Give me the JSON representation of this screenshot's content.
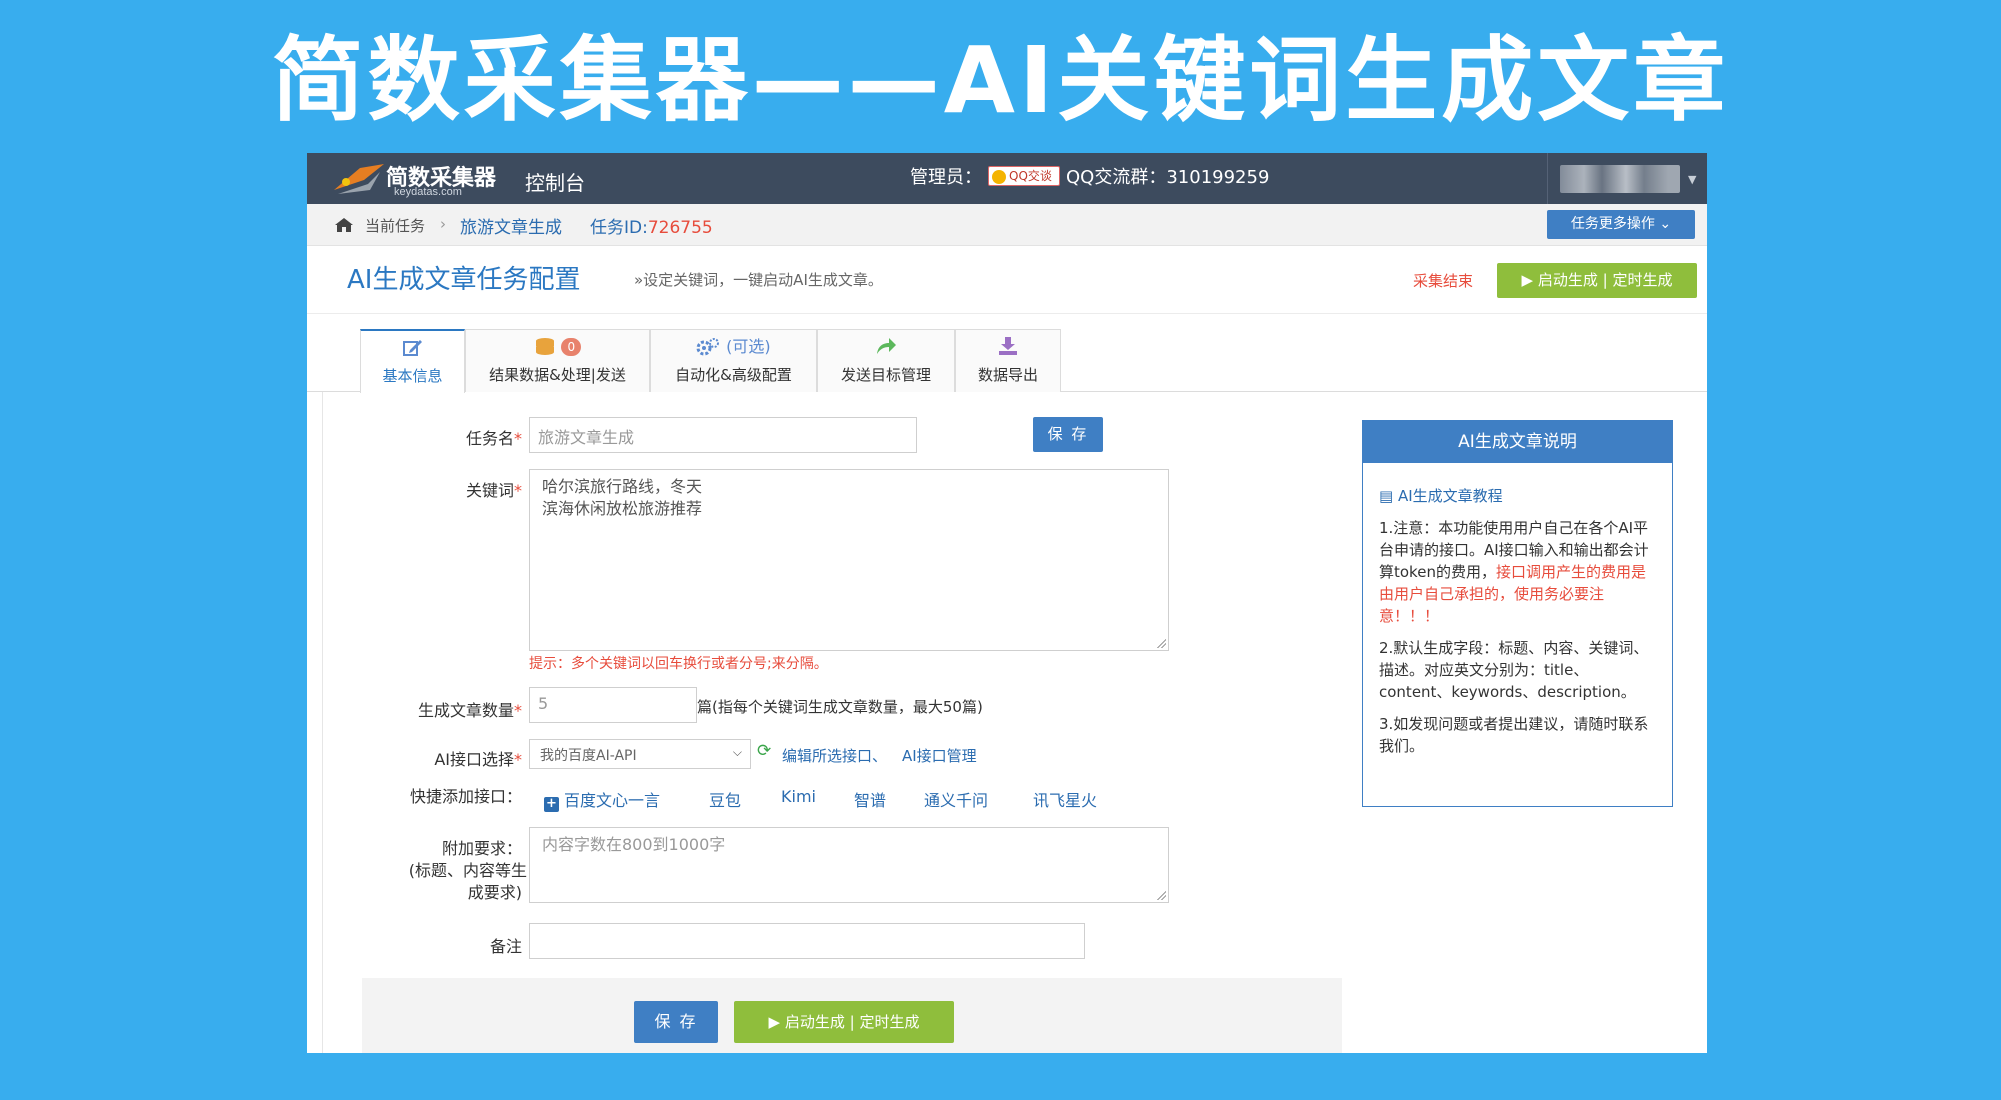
{
  "banner": {
    "title": "简数采集器——AI关键词生成文章"
  },
  "topbar": {
    "logo_text": "简数采集器",
    "logo_sub": "keydatas.com",
    "console": "控制台",
    "admin_label": "管理员：",
    "qq_badge": "QQ交谈",
    "qq_group": "QQ交流群：310199259"
  },
  "breadcrumb": {
    "current": "当前任务",
    "separator": "›",
    "task_name": "旅游文章生成",
    "task_id_label": "任务ID:",
    "task_id": "726755",
    "more_button": "任务更多操作 ⌄"
  },
  "header": {
    "title": "AI生成文章任务配置",
    "subtitle": "»设定关键词，一键启动AI生成文章。",
    "collect_end": "采集结束",
    "start_button": "▶ 启动生成 | 定时生成"
  },
  "tabs": [
    {
      "label": "基本信息",
      "icon": "edit-icon"
    },
    {
      "label": "结果数据&处理|发送",
      "icon": "database-icon",
      "badge": "0"
    },
    {
      "label": "自动化&高级配置",
      "icon": "gears-icon",
      "extra": "(可选)"
    },
    {
      "label": "发送目标管理",
      "icon": "share-arrow-icon"
    },
    {
      "label": "数据导出",
      "icon": "download-icon"
    }
  ],
  "form": {
    "task_name_label": "任务名",
    "task_name_value": "旅游文章生成",
    "save_small": "保 存",
    "keywords_label": "关键词",
    "keywords_lines": [
      "哈尔滨旅行路线，冬天",
      "滨海休闲放松旅游推荐"
    ],
    "keywords_hint": "提示：多个关键词以回车换行或者分号;来分隔。",
    "count_label": "生成文章数量",
    "count_value": "5",
    "count_note": "篇(指每个关键词生成文章数量，最大50篇)",
    "api_label": "AI接口选择",
    "api_selected": "我的百度AI-API",
    "edit_api_link": "编辑所选接口、",
    "manage_api_link": "AI接口管理",
    "quick_label": "快捷添加接口：",
    "quick_items": [
      "百度文心一言",
      "豆包",
      "Kimi",
      "智谱",
      "通义千问",
      "讯飞星火"
    ],
    "extra_label_1": "附加要求：",
    "extra_label_2": "(标题、内容等生",
    "extra_label_3": "成要求)",
    "extra_placeholder": "内容字数在800到1000字",
    "remark_label": "备注",
    "remark_value": "",
    "save_button": "保 存",
    "start_button": "▶ 启动生成 | 定时生成"
  },
  "side_panel": {
    "title": "AI生成文章说明",
    "tutorial_link": "AI生成文章教程",
    "p1_normal": "1.注意：本功能使用用户自己在各个AI平台申请的接口。AI接口输入和输出都会计算token的费用，",
    "p1_red": "接口调用产生的费用是由用户自己承担的，使用务必要注意！！！",
    "p2": "2.默认生成字段：标题、内容、关键词、描述。对应英文分别为：title、content、keywords、description。",
    "p3": "3.如发现问题或者提出建议，请随时联系我们。"
  },
  "colors": {
    "background": "#38adee",
    "topbar": "#3d4b5e",
    "primary": "#3f7fc4",
    "green": "#8fbe3c",
    "red": "#e74c3c"
  }
}
